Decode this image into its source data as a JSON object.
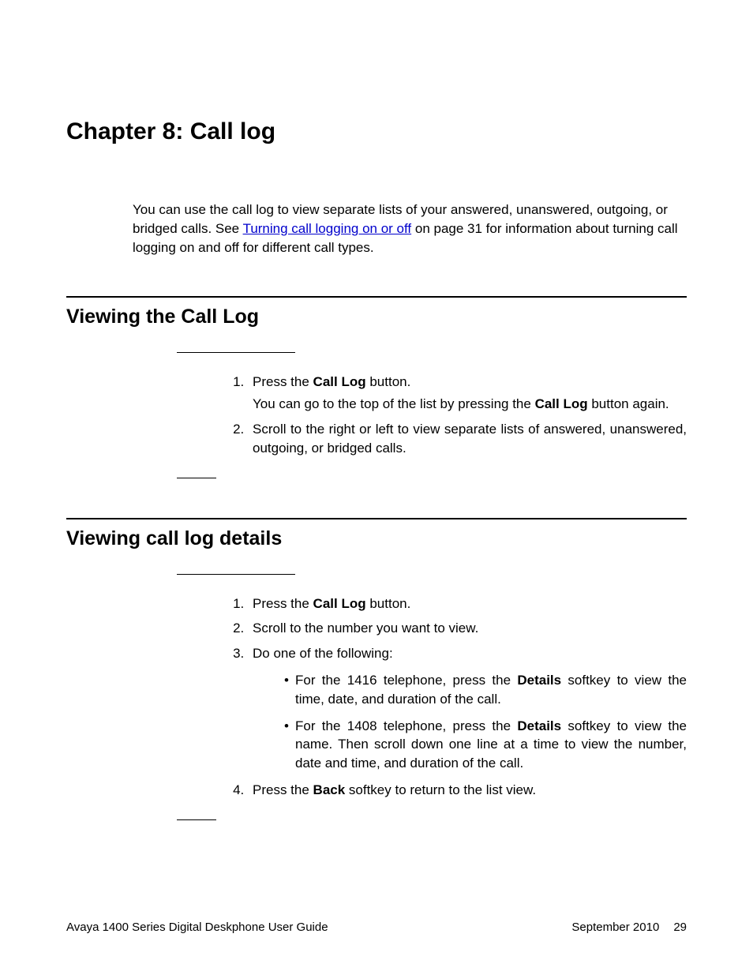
{
  "chapter": {
    "title": "Chapter 8:  Call log"
  },
  "intro": {
    "pre": "You can use the call log to view separate lists of your answered, unanswered, outgoing, or bridged calls. See ",
    "link": "Turning call logging on or off",
    "post": " on page 31 for information about turning call logging on and off for different call types."
  },
  "section1": {
    "title": "Viewing the Call Log",
    "step1_pre": "Press the ",
    "step1_b": "Call Log",
    "step1_post": " button.",
    "step1b_pre": "You can go to the top of the list by pressing the ",
    "step1b_b": "Call Log",
    "step1b_post": " button again.",
    "step2": "Scroll to the right or left to view separate lists of answered, unanswered, outgoing, or bridged calls."
  },
  "section2": {
    "title": "Viewing call log details",
    "step1_pre": "Press the ",
    "step1_b": "Call Log",
    "step1_post": " button.",
    "step2": "Scroll to the number you want to view.",
    "step3": "Do one of the following:",
    "b1_pre": "For the 1416 telephone, press the ",
    "b1_b": "Details",
    "b1_post": " softkey to view the time, date, and duration of the call.",
    "b2_pre": "For the 1408 telephone, press the ",
    "b2_b": "Details",
    "b2_post": " softkey to view the name. Then scroll down one line at a time to view the number, date and time, and duration of the call.",
    "step4_pre": "Press the ",
    "step4_b": "Back",
    "step4_post": " softkey to return to the list view."
  },
  "footer": {
    "left": "Avaya 1400 Series Digital Deskphone User Guide",
    "date": "September 2010",
    "page": "29"
  }
}
